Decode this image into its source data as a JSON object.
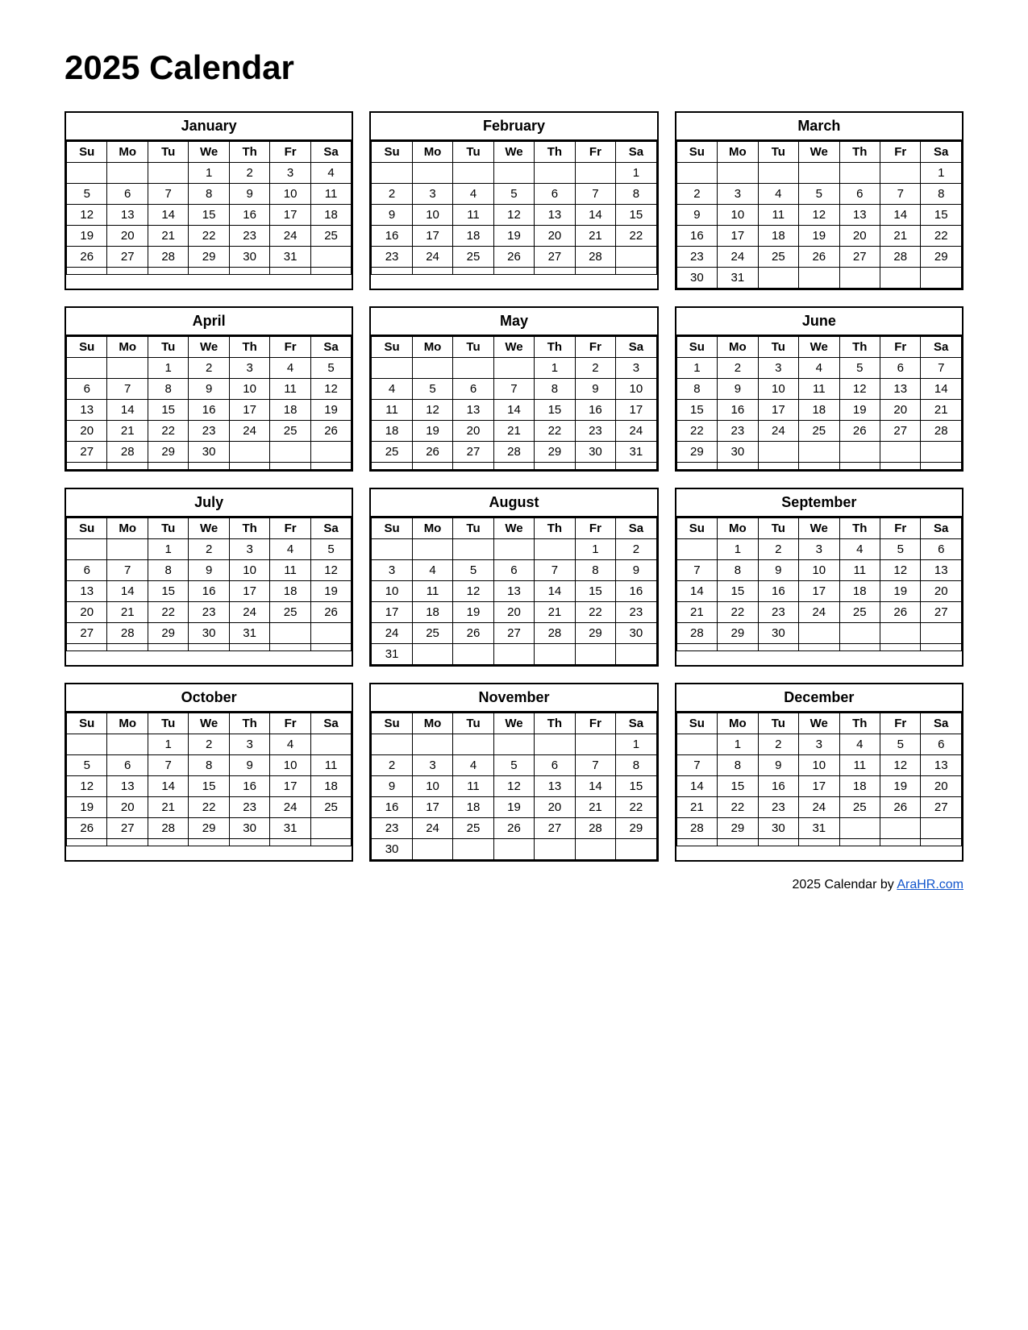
{
  "title": "2025 Calendar",
  "footer": "2025  Calendar by ",
  "footer_link": "AraHR.com",
  "days_header": [
    "Su",
    "Mo",
    "Tu",
    "We",
    "Th",
    "Fr",
    "Sa"
  ],
  "months": [
    {
      "name": "January",
      "weeks": [
        [
          "",
          "",
          "",
          "1",
          "2",
          "3",
          "4"
        ],
        [
          "5",
          "6",
          "7",
          "8",
          "9",
          "10",
          "11"
        ],
        [
          "12",
          "13",
          "14",
          "15",
          "16",
          "17",
          "18"
        ],
        [
          "19",
          "20",
          "21",
          "22",
          "23",
          "24",
          "25"
        ],
        [
          "26",
          "27",
          "28",
          "29",
          "30",
          "31",
          ""
        ],
        [
          "",
          "",
          "",
          "",
          "",
          "",
          ""
        ]
      ]
    },
    {
      "name": "February",
      "weeks": [
        [
          "",
          "",
          "",
          "",
          "",
          "",
          "1"
        ],
        [
          "2",
          "3",
          "4",
          "5",
          "6",
          "7",
          "8"
        ],
        [
          "9",
          "10",
          "11",
          "12",
          "13",
          "14",
          "15"
        ],
        [
          "16",
          "17",
          "18",
          "19",
          "20",
          "21",
          "22"
        ],
        [
          "23",
          "24",
          "25",
          "26",
          "27",
          "28",
          ""
        ],
        [
          "",
          "",
          "",
          "",
          "",
          "",
          ""
        ]
      ]
    },
    {
      "name": "March",
      "weeks": [
        [
          "",
          "",
          "",
          "",
          "",
          "",
          "1"
        ],
        [
          "2",
          "3",
          "4",
          "5",
          "6",
          "7",
          "8"
        ],
        [
          "9",
          "10",
          "11",
          "12",
          "13",
          "14",
          "15"
        ],
        [
          "16",
          "17",
          "18",
          "19",
          "20",
          "21",
          "22"
        ],
        [
          "23",
          "24",
          "25",
          "26",
          "27",
          "28",
          "29"
        ],
        [
          "30",
          "31",
          "",
          "",
          "",
          "",
          ""
        ]
      ]
    },
    {
      "name": "April",
      "weeks": [
        [
          "",
          "",
          "1",
          "2",
          "3",
          "4",
          "5"
        ],
        [
          "6",
          "7",
          "8",
          "9",
          "10",
          "11",
          "12"
        ],
        [
          "13",
          "14",
          "15",
          "16",
          "17",
          "18",
          "19"
        ],
        [
          "20",
          "21",
          "22",
          "23",
          "24",
          "25",
          "26"
        ],
        [
          "27",
          "28",
          "29",
          "30",
          "",
          "",
          ""
        ],
        [
          "",
          "",
          "",
          "",
          "",
          "",
          ""
        ]
      ]
    },
    {
      "name": "May",
      "weeks": [
        [
          "",
          "",
          "",
          "",
          "1",
          "2",
          "3"
        ],
        [
          "4",
          "5",
          "6",
          "7",
          "8",
          "9",
          "10"
        ],
        [
          "11",
          "12",
          "13",
          "14",
          "15",
          "16",
          "17"
        ],
        [
          "18",
          "19",
          "20",
          "21",
          "22",
          "23",
          "24"
        ],
        [
          "25",
          "26",
          "27",
          "28",
          "29",
          "30",
          "31"
        ],
        [
          "",
          "",
          "",
          "",
          "",
          "",
          ""
        ]
      ]
    },
    {
      "name": "June",
      "weeks": [
        [
          "1",
          "2",
          "3",
          "4",
          "5",
          "6",
          "7"
        ],
        [
          "8",
          "9",
          "10",
          "11",
          "12",
          "13",
          "14"
        ],
        [
          "15",
          "16",
          "17",
          "18",
          "19",
          "20",
          "21"
        ],
        [
          "22",
          "23",
          "24",
          "25",
          "26",
          "27",
          "28"
        ],
        [
          "29",
          "30",
          "",
          "",
          "",
          "",
          ""
        ],
        [
          "",
          "",
          "",
          "",
          "",
          "",
          ""
        ]
      ]
    },
    {
      "name": "July",
      "weeks": [
        [
          "",
          "",
          "1",
          "2",
          "3",
          "4",
          "5"
        ],
        [
          "6",
          "7",
          "8",
          "9",
          "10",
          "11",
          "12"
        ],
        [
          "13",
          "14",
          "15",
          "16",
          "17",
          "18",
          "19"
        ],
        [
          "20",
          "21",
          "22",
          "23",
          "24",
          "25",
          "26"
        ],
        [
          "27",
          "28",
          "29",
          "30",
          "31",
          "",
          ""
        ],
        [
          "",
          "",
          "",
          "",
          "",
          "",
          ""
        ]
      ]
    },
    {
      "name": "August",
      "weeks": [
        [
          "",
          "",
          "",
          "",
          "",
          "1",
          "2"
        ],
        [
          "3",
          "4",
          "5",
          "6",
          "7",
          "8",
          "9"
        ],
        [
          "10",
          "11",
          "12",
          "13",
          "14",
          "15",
          "16"
        ],
        [
          "17",
          "18",
          "19",
          "20",
          "21",
          "22",
          "23"
        ],
        [
          "24",
          "25",
          "26",
          "27",
          "28",
          "29",
          "30"
        ],
        [
          "31",
          "",
          "",
          "",
          "",
          "",
          ""
        ]
      ]
    },
    {
      "name": "September",
      "weeks": [
        [
          "",
          "1",
          "2",
          "3",
          "4",
          "5",
          "6"
        ],
        [
          "7",
          "8",
          "9",
          "10",
          "11",
          "12",
          "13"
        ],
        [
          "14",
          "15",
          "16",
          "17",
          "18",
          "19",
          "20"
        ],
        [
          "21",
          "22",
          "23",
          "24",
          "25",
          "26",
          "27"
        ],
        [
          "28",
          "29",
          "30",
          "",
          "",
          "",
          ""
        ],
        [
          "",
          "",
          "",
          "",
          "",
          "",
          ""
        ]
      ]
    },
    {
      "name": "October",
      "weeks": [
        [
          "",
          "",
          "1",
          "2",
          "3",
          "4",
          ""
        ],
        [
          "5",
          "6",
          "7",
          "8",
          "9",
          "10",
          "11"
        ],
        [
          "12",
          "13",
          "14",
          "15",
          "16",
          "17",
          "18"
        ],
        [
          "19",
          "20",
          "21",
          "22",
          "23",
          "24",
          "25"
        ],
        [
          "26",
          "27",
          "28",
          "29",
          "30",
          "31",
          ""
        ],
        [
          "",
          "",
          "",
          "",
          "",
          "",
          ""
        ]
      ]
    },
    {
      "name": "November",
      "weeks": [
        [
          "",
          "",
          "",
          "",
          "",
          "",
          "1"
        ],
        [
          "2",
          "3",
          "4",
          "5",
          "6",
          "7",
          "8"
        ],
        [
          "9",
          "10",
          "11",
          "12",
          "13",
          "14",
          "15"
        ],
        [
          "16",
          "17",
          "18",
          "19",
          "20",
          "21",
          "22"
        ],
        [
          "23",
          "24",
          "25",
          "26",
          "27",
          "28",
          "29"
        ],
        [
          "30",
          "",
          "",
          "",
          "",
          "",
          ""
        ]
      ]
    },
    {
      "name": "December",
      "weeks": [
        [
          "",
          "1",
          "2",
          "3",
          "4",
          "5",
          "6"
        ],
        [
          "7",
          "8",
          "9",
          "10",
          "11",
          "12",
          "13"
        ],
        [
          "14",
          "15",
          "16",
          "17",
          "18",
          "19",
          "20"
        ],
        [
          "21",
          "22",
          "23",
          "24",
          "25",
          "26",
          "27"
        ],
        [
          "28",
          "29",
          "30",
          "31",
          "",
          "",
          ""
        ],
        [
          "",
          "",
          "",
          "",
          "",
          "",
          ""
        ]
      ]
    }
  ]
}
